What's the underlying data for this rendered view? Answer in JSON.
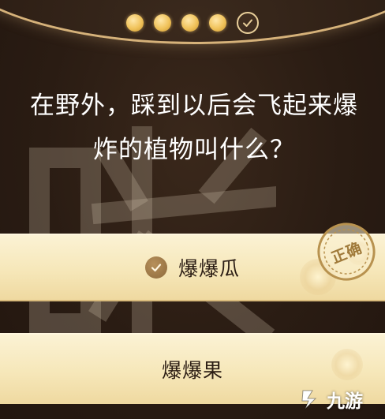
{
  "progress": {
    "total": 5,
    "answered": 4,
    "current_state": "completed"
  },
  "question": {
    "line1": "在野外，踩到以后会飞起来爆",
    "line2": "炸的植物叫什么？"
  },
  "options": [
    {
      "label": "爆爆瓜",
      "status": "selected-correct"
    },
    {
      "label": "爆爆果",
      "status": "unselected"
    }
  ],
  "stamp": {
    "label": "正确"
  },
  "watermark": {
    "logo_text": "九游"
  },
  "colors": {
    "background": "#2b1d14",
    "gold_accent": "#d6b27a",
    "option_fill": "#f6e7b9",
    "check_fill": "#8d6a3c",
    "text_dark": "#2b1d14",
    "text_light": "#ffffff"
  },
  "icons": {
    "progress_complete": "check-circle-icon",
    "option_correct": "check-circle-icon",
    "logo": "jiuyou-logo-icon"
  }
}
